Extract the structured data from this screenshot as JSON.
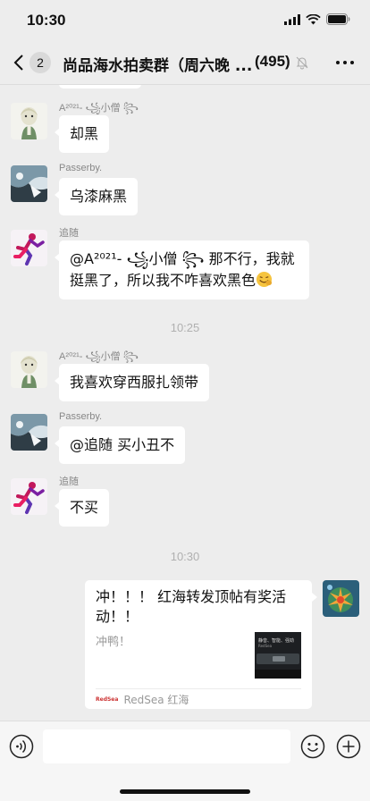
{
  "status": {
    "time": "10:30"
  },
  "header": {
    "unread": "2",
    "title": "尚品海水拍卖群（周六晚 ...",
    "count": "(495)"
  },
  "messages": [
    {
      "sender": "A²⁰²¹- ꧁小僧 ꧂",
      "text": "却黑"
    },
    {
      "sender": "Passerby.",
      "text": "乌漆麻黑"
    },
    {
      "sender": "追随",
      "mention": "@A²⁰²¹- ꧁小僧 ꧂",
      "text": " 那不行，我就挺黑了，所以我不咋喜欢黑色"
    },
    {
      "sender": "A²⁰²¹- ꧁小僧 ꧂",
      "text": "我喜欢穿西服扎领带"
    },
    {
      "sender": "Passerby.",
      "text": "@追随 买小丑不"
    },
    {
      "sender": "追随",
      "text": "不买"
    }
  ],
  "timestamps": [
    "10:25",
    "10:30"
  ],
  "link_card": {
    "title": "冲！！！ 红海转发顶帖有奖活动！！",
    "description": "冲鸭！",
    "thumb_text": "静音、智能、强劲",
    "thumb_logo": "RedSea",
    "source_logo": "RedSea",
    "source": "RedSea 红海"
  },
  "input": {
    "placeholder": ""
  },
  "icons": {
    "back": "chevron-left-icon",
    "mute": "bell-off-icon",
    "more": "more-icon",
    "voice": "voice-icon",
    "emoji": "emoji-icon",
    "plus": "plus-icon"
  }
}
